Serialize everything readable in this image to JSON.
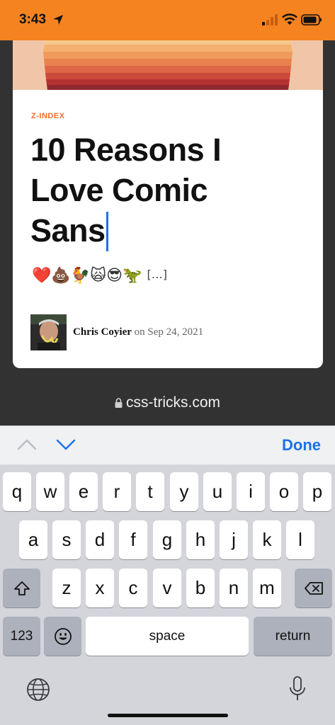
{
  "status_bar": {
    "time": "3:43"
  },
  "article": {
    "kicker": "Z-INDEX",
    "title": "10 Reasons I Love Comic Sans",
    "excerpt_emojis": "❤️💩🐓🙀😎🦖",
    "excerpt_more": "[…]",
    "author": "Chris Coyier",
    "date_text": " on Sep 24, 2021"
  },
  "browser": {
    "url": "css-tricks.com"
  },
  "toolbar": {
    "done_label": "Done"
  },
  "keyboard": {
    "row1": [
      "q",
      "w",
      "e",
      "r",
      "t",
      "y",
      "u",
      "i",
      "o",
      "p"
    ],
    "row2": [
      "a",
      "s",
      "d",
      "f",
      "g",
      "h",
      "j",
      "k",
      "l"
    ],
    "row3": [
      "z",
      "x",
      "c",
      "v",
      "b",
      "n",
      "m"
    ],
    "numbers_label": "123",
    "space_label": "space",
    "return_label": "return"
  },
  "colors": {
    "status_bar": "#f5831f",
    "accent": "#1a73e8",
    "kicker": "#f26a2e"
  }
}
